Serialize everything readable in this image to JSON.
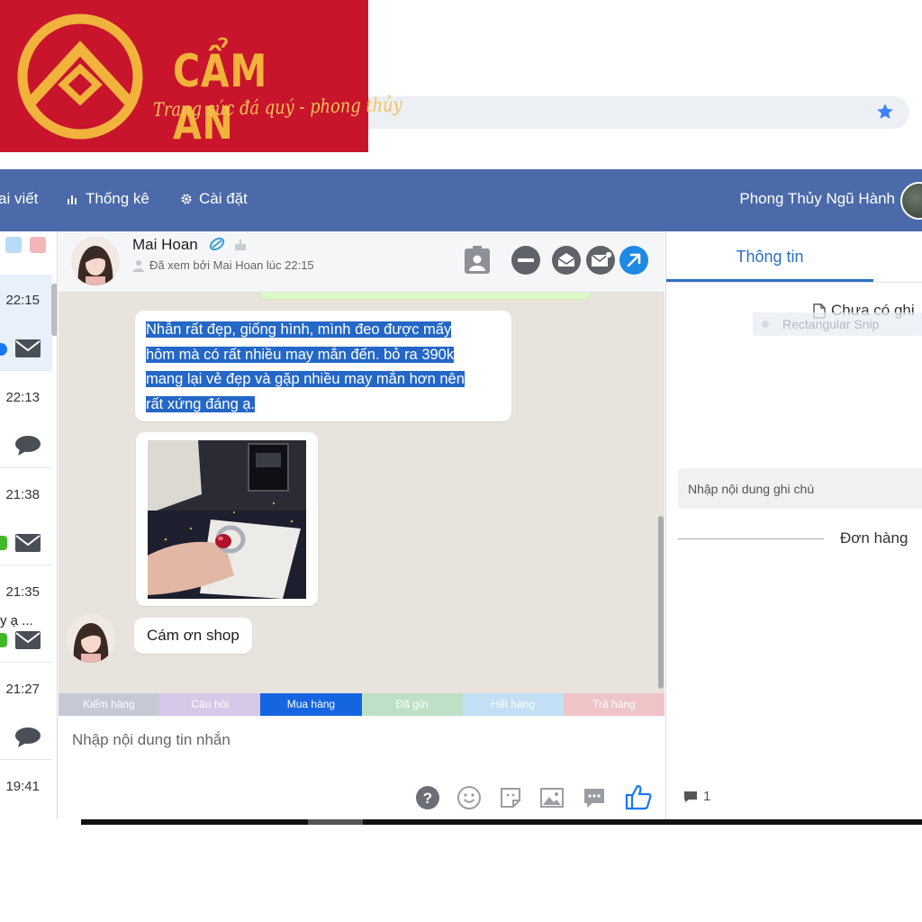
{
  "logo": {
    "title": "CẨM AN",
    "slogan": "Trang sức đá quý - phong thủy",
    "colors": {
      "background": "#c8152b",
      "gold": "#f2b33d"
    }
  },
  "browser": {
    "star_icon": "star-icon",
    "star_color": "#3b82f6"
  },
  "nav": {
    "item_posts": "ai viết",
    "item_stats": "Thống kê",
    "item_settings": "Cài đặt",
    "page_name": "Phong Thủy Ngũ Hành",
    "color": "#4b6aa9"
  },
  "conversations": [
    {
      "time": "22:15",
      "snippet": "",
      "icon": "mail-icon",
      "indicator": "blue-dot",
      "active": true
    },
    {
      "time": "22:13",
      "snippet": "",
      "icon": "chat-bubble-icon",
      "indicator": "",
      "active": false
    },
    {
      "time": "21:38",
      "snippet": "",
      "icon": "mail-icon",
      "indicator": "green-badge",
      "active": false
    },
    {
      "time": "21:35",
      "snippet": "y ạ ...",
      "icon": "mail-icon",
      "indicator": "green-badge",
      "active": false
    },
    {
      "time": "21:27",
      "snippet": "",
      "icon": "chat-bubble-icon",
      "indicator": "",
      "active": false
    },
    {
      "time": "19:41",
      "snippet": "",
      "icon": "",
      "indicator": "",
      "active": false
    }
  ],
  "chat": {
    "name": "Mai Hoan",
    "seen_text": "Đã xem bởi Mai Hoan lúc 22:15",
    "messages": {
      "review_lines": [
        "Nhẫn rất đẹp, giống hình, mình đeo được mấy",
        "hôm mà có rất nhiều may mắn đến. bỏ ra 390k",
        "mang lại vẻ đẹp và gặp nhiều may mắn hơn nên",
        "rất xứng đáng ạ."
      ],
      "thanks": "Cám ơn shop"
    }
  },
  "tags": [
    {
      "label": "Kiểm hàng",
      "color": "#c5c9d6"
    },
    {
      "label": "Câu hỏi",
      "color": "#d8c8e8"
    },
    {
      "label": "Mua hàng",
      "color": "#1565e0"
    },
    {
      "label": "Đã gửi",
      "color": "#bfe0c6"
    },
    {
      "label": "Hết hàng",
      "color": "#c3dff5"
    },
    {
      "label": "Trả hàng",
      "color": "#efc4c7"
    }
  ],
  "composer": {
    "placeholder": "Nhập nội dung tin nhắn",
    "like_color": "#1877f2"
  },
  "info_panel": {
    "tab": "Thông tin",
    "no_note": "Chưa có ghi",
    "snip_ghost": "Rectangular Snip",
    "note_placeholder": "Nhập nội dung ghi chú",
    "orders_label": "Đơn hàng",
    "comment_count": "1"
  }
}
